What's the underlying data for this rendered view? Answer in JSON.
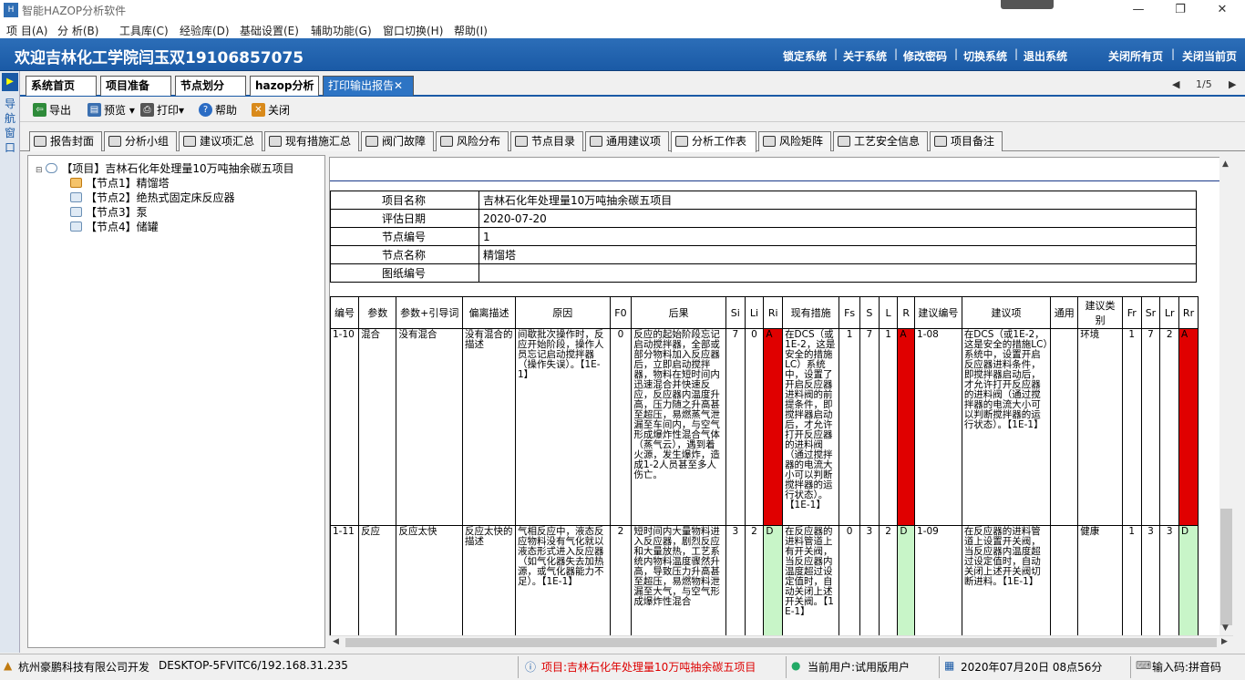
{
  "window": {
    "title": "智能HAZOP分析软件",
    "app_icon": "HAZOP",
    "controls": {
      "minimize": "—",
      "restore": "❐",
      "close": "✕"
    }
  },
  "menu": [
    "项 目(A)",
    "分 析(B)",
    "工具库(C)",
    "经验库(D)",
    "基础设置(E)",
    "辅助功能(G)",
    "窗口切换(H)",
    "帮助(I)"
  ],
  "banner": {
    "welcome": "欢迎吉林化工学院闫玉双19106857075",
    "links": [
      "锁定系统",
      "关于系统",
      "修改密码",
      "切换系统",
      "退出系统"
    ],
    "right_links": [
      "关闭所有页",
      "关闭当前页"
    ],
    "separator": "|"
  },
  "left_strip": {
    "text": "导航窗口",
    "button": "▶"
  },
  "main_tabs": [
    {
      "label": "系统首页",
      "active": false
    },
    {
      "label": "项目准备",
      "active": false
    },
    {
      "label": "节点划分",
      "active": false
    },
    {
      "label": "hazop分析",
      "active": false
    },
    {
      "label": "打印输出报告✕",
      "active": true
    }
  ],
  "pager": {
    "prev": "◀",
    "text": "1/5",
    "next": "▶"
  },
  "toolbar": [
    {
      "label": "导出",
      "icon": "export-icon",
      "color": "#2e8b3a"
    },
    {
      "label": "预览 ▾",
      "icon": "preview-icon",
      "color": "#3a6fb0"
    },
    {
      "label": "打印▾",
      "icon": "print-icon",
      "color": "#555555"
    },
    {
      "label": "帮助",
      "icon": "help-icon",
      "color": "#2b6cc4"
    },
    {
      "label": "关闭",
      "icon": "close-icon",
      "color": "#d98a1b"
    }
  ],
  "report_tabs": [
    "报告封面",
    "分析小组",
    "建议项汇总",
    "现有措施汇总",
    "阀门故障",
    "风险分布",
    "节点目录",
    "通用建议项",
    "分析工作表",
    "风险矩阵",
    "工艺安全信息",
    "项目备注"
  ],
  "active_report_tab": "分析工作表",
  "tree": {
    "root": "【项目】吉林石化年处理量10万吨抽余碳五项目",
    "nodes": [
      "【节点1】精馏塔",
      "【节点2】绝热式固定床反应器",
      "【节点3】泵",
      "【节点4】储罐"
    ]
  },
  "info_table": [
    {
      "label": "项目名称",
      "value": "吉林石化年处理量10万吨抽余碳五项目"
    },
    {
      "label": "评估日期",
      "value": "2020-07-20"
    },
    {
      "label": "节点编号",
      "value": "1"
    },
    {
      "label": "节点名称",
      "value": "精馏塔"
    },
    {
      "label": "图纸编号",
      "value": ""
    }
  ],
  "worksheet": {
    "headers": [
      "编号",
      "参数",
      "参数+引导词",
      "偏离描述",
      "原因",
      "F0",
      "后果",
      "Si",
      "Li",
      "Ri",
      "现有措施",
      "Fs",
      "S",
      "L",
      "R",
      "建议编号",
      "建议项",
      "通用",
      "建议类别",
      "Fr",
      "Sr",
      "Lr",
      "Rr"
    ],
    "rows": [
      {
        "id": "1-10",
        "param": "混合",
        "guide": "没有混合",
        "deviation": "没有混合的描述",
        "cause": "间歇批次操作时，反应开始阶段，操作人员忘记启动搅拌器（操作失误）。【1E-1】",
        "f0": "0",
        "consequence": "反应的起始阶段忘记启动搅拌器，全部或部分物料加入反应器后，立即启动搅拌器，物料在短时间内迅速混合并快速反应，反应器内温度升高，压力随之升高甚至超压，易燃蒸气泄漏至车间内，与空气形成爆炸性混合气体（蒸气云），遇到着火源，发生爆炸，造成1-2人员甚至多人伤亡。",
        "si": "7",
        "li": "0",
        "ri": "A",
        "measures": "在DCS（或1E-2，这是安全的措施LC）系统中，设置了开启反应器进料阀的前提条件，即搅拌器启动后，才允许打开反应器的进料阀（通过搅拌器的电流大小可以判断搅拌器的运行状态）。【1E-1】",
        "fs": "1",
        "s": "7",
        "l": "1",
        "r": "A",
        "rec_id": "1-08",
        "recommendation": "在DCS（或1E-2，这是安全的措施LC）系统中，设置开启反应器进料条件，即搅拌器启动后，才允许打开反应器的进料阀（通过搅拌器的电流大小可以判断搅拌器的运行状态）。【1E-1】",
        "general": "",
        "category": "环境",
        "fr": "1",
        "sr": "7",
        "lr": "2",
        "rr": "A"
      },
      {
        "id": "1-11",
        "param": "反应",
        "guide": "反应太快",
        "deviation": "反应太快的描述",
        "cause": "气相反应中，液态反应物料没有气化就以液态形式进入反应器（如气化器失去加热源，或气化器能力不足）。【1E-1】",
        "f0": "2",
        "consequence": "短时间内大量物料进入反应器，剧烈反应和大量放热，工艺系统内物料温度骤然升高，导致压力升高甚至超压，易燃物料泄漏至大气，与空气形成爆炸性混合",
        "si": "3",
        "li": "2",
        "ri": "D",
        "measures": "在反应器的进料管道上有开关阀，当反应器内温度超过设定值时，自动关闭上述开关阀。【1E-1】",
        "fs": "0",
        "s": "3",
        "l": "2",
        "r": "D",
        "rec_id": "1-09",
        "recommendation": "在反应器的进料管道上设置开关阀，当反应器内温度超过设定值时，自动关闭上述开关阀切断进料。【1E-1】",
        "general": "",
        "category": "健康",
        "fr": "1",
        "sr": "3",
        "lr": "3",
        "rr": "D"
      }
    ]
  },
  "colors": {
    "risk_A": "#e00000",
    "risk_D": "#c8f5c8",
    "banner": "#1f63b0"
  },
  "statusbar": {
    "company": "杭州豪鹏科技有限公司开发",
    "host": "DESKTOP-5FVITC6/192.168.31.235",
    "project": "项目:吉林石化年处理量10万吨抽余碳五项目",
    "user": "当前用户:试用版用户",
    "datetime": "2020年07月20日 08点56分",
    "input": "输入码:拼音码"
  }
}
